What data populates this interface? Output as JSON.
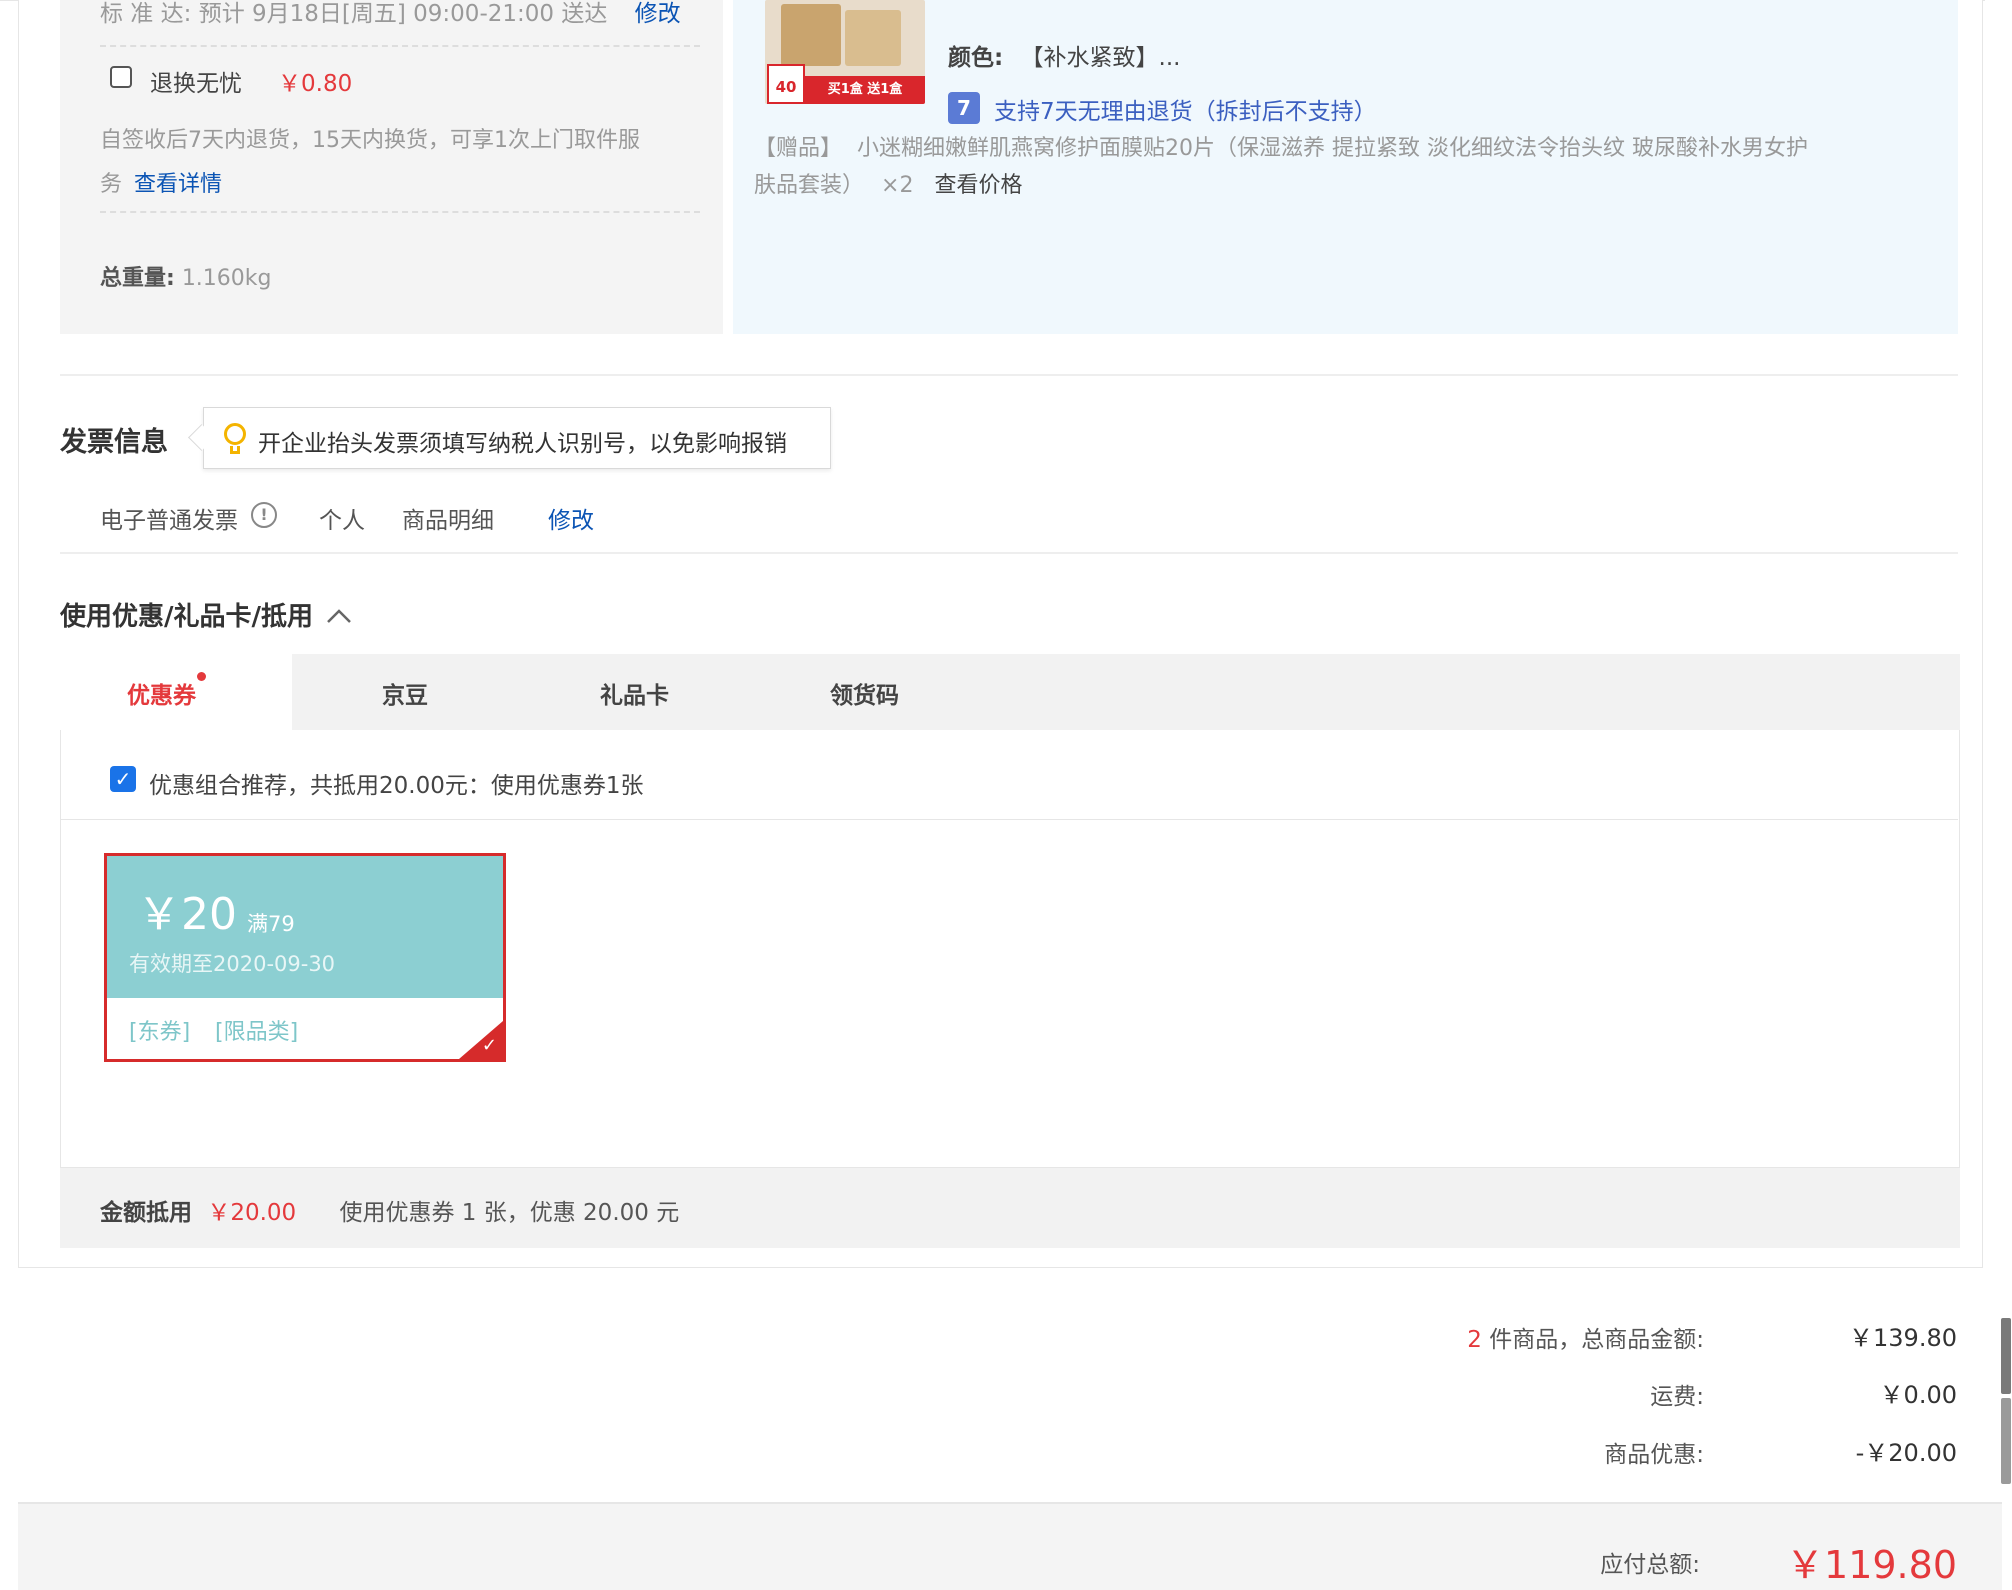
{
  "shipment": {
    "delivery_label": "标  准  达:",
    "delivery_text": "预计 9月18日[周五] 09:00-21:00 送达",
    "delivery_edit": "修改",
    "return_service_label": "退换无忧",
    "return_service_price": "￥0.80",
    "return_desc_1": "自签收后7天内退货，15天内换货，可享1次上门取件服",
    "return_desc_2": "务",
    "return_details_link": "查看详情",
    "weight_label": "总重量:",
    "weight_value": "1.160kg"
  },
  "product": {
    "image_banner": "买1盒 送1盒",
    "image_tag": "40",
    "color_label": "颜色:",
    "color_value": "【补水紧致】...",
    "return_badge": "7",
    "return_policy": "支持7天无理由退货（拆封后不支持）",
    "gift_label": "【赠品】",
    "gift_line_1": "小迷糊细嫩鲜肌燕窝修护面膜贴20片（保湿滋养 提拉紧致 淡化细纹法令抬头纹 玻尿酸补水男女护",
    "gift_line_2": "肤品套装）",
    "gift_qty": "×2",
    "gift_price_link": "查看价格"
  },
  "invoice": {
    "title": "发票信息",
    "tip": "开企业抬头发票须填写纳税人识别号，以免影响报销",
    "type": "电子普通发票",
    "type_info_icon": "!",
    "title_type": "个人",
    "content": "商品明细",
    "edit": "修改"
  },
  "discount": {
    "title": "使用优惠/礼品卡/抵用",
    "tabs": [
      {
        "label": "优惠券"
      },
      {
        "label": "京豆"
      },
      {
        "label": "礼品卡"
      },
      {
        "label": "领货码"
      }
    ],
    "recommend_text": "优惠组合推荐，共抵用20.00元：使用优惠券1张",
    "coupon": {
      "amount": "￥20",
      "threshold": "满79",
      "validity": "有效期至2020-09-30",
      "tag_1": "[东券]",
      "tag_2": "[限品类]"
    },
    "summary_label": "金额抵用",
    "summary_amount": "￥20.00",
    "summary_desc": "使用优惠券 1 张，优惠 20.00 元"
  },
  "totals": {
    "item_count": "2",
    "items_label": "件商品，总商品金额:",
    "items_amount": "￥139.80",
    "shipping_label": "运费:",
    "shipping_amount": "￥0.00",
    "discount_label": "商品优惠:",
    "discount_amount": "-￥20.00",
    "payable_label": "应付总额:",
    "payable_amount": "￥119.80"
  },
  "colors": {
    "accent_red": "#e4393c",
    "link_blue": "#0b54b4",
    "coupon_teal": "#8ccfd2"
  }
}
